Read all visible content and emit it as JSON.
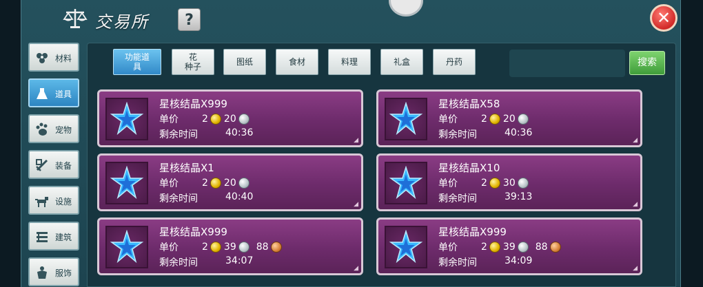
{
  "header": {
    "title": "交易所",
    "help_label": "?",
    "close_label": "✕"
  },
  "sidebar": {
    "items": [
      {
        "label": "材料",
        "icon": "flower-icon",
        "active": false
      },
      {
        "label": "道具",
        "icon": "flask-icon",
        "active": true
      },
      {
        "label": "宠物",
        "icon": "paw-icon",
        "active": false
      },
      {
        "label": "装备",
        "icon": "sword-icon",
        "active": false
      },
      {
        "label": "设施",
        "icon": "horse-icon",
        "active": false
      },
      {
        "label": "建筑",
        "icon": "fence-icon",
        "active": false
      },
      {
        "label": "服饰",
        "icon": "shirt-icon",
        "active": false
      }
    ]
  },
  "tabs": [
    {
      "label": "功能道\n具",
      "active": true
    },
    {
      "label": "花\n种子",
      "active": false
    },
    {
      "label": "图纸",
      "active": false
    },
    {
      "label": "食材",
      "active": false
    },
    {
      "label": "料理",
      "active": false
    },
    {
      "label": "礼盒",
      "active": false
    },
    {
      "label": "丹药",
      "active": false
    }
  ],
  "search": {
    "value": "",
    "button_label": "搜索"
  },
  "labels": {
    "price": "单价",
    "remaining": "剩余时间"
  },
  "listings": [
    {
      "name": "星核结晶X999",
      "gold": "2",
      "silver": "20",
      "copper": "",
      "time": "40:36"
    },
    {
      "name": "星核结晶X58",
      "gold": "2",
      "silver": "20",
      "copper": "",
      "time": "40:36"
    },
    {
      "name": "星核结晶X1",
      "gold": "2",
      "silver": "20",
      "copper": "",
      "time": "40:40"
    },
    {
      "name": "星核结晶X10",
      "gold": "2",
      "silver": "30",
      "copper": "",
      "time": "39:13"
    },
    {
      "name": "星核结晶X999",
      "gold": "2",
      "silver": "39",
      "copper": "88",
      "time": "34:07"
    },
    {
      "name": "星核结晶X999",
      "gold": "2",
      "silver": "39",
      "copper": "88",
      "time": "34:09"
    }
  ],
  "colors": {
    "active_tab": "#3189c8",
    "card": "#7a3276",
    "search_button": "#4fae46"
  }
}
